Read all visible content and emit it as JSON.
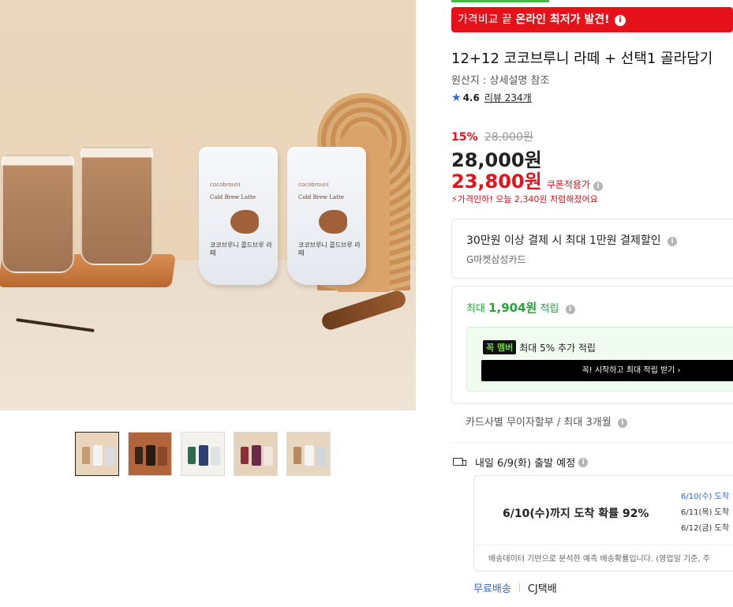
{
  "banner": {
    "prefix": "가격비교 끝 ",
    "strong": "온라인 최저가 발견!",
    "info": "i"
  },
  "product": {
    "title": "12+12 코코브루니 라떼 + 선택1 골라담기",
    "origin": "원산지 : 상세설명 참조",
    "rating": "4.6",
    "review_text": "리뷰 234개"
  },
  "price": {
    "discount_pct": "15%",
    "original": "28,000원",
    "main": "28,000원",
    "coupon": "23,800원",
    "coupon_label": "쿠폰적용가",
    "drop_note": "가격인하! 오늘 2,340원 저렴해졌어요"
  },
  "card_discount": {
    "title": "30만원 이상 결제 시 최대 1만원 결제할인",
    "card": "G마켓삼성카드"
  },
  "points": {
    "prefix": "최대 ",
    "amount": "1,904원",
    "suffix": " 적립",
    "member_badge": "꼭 멤버",
    "member_text": "최대 5% 추가 적립",
    "member_button": "꼭! 시작하고 최대 적립 받기  ›"
  },
  "installment": "카드사별 무이자할부 / 최대 3개월",
  "shipping": {
    "title": "내일 6/9(화) 출발 예정",
    "probability": "6/10(수)까지 도착 확률 92%",
    "dates": [
      "6/10(수) 도착",
      "6/11(목) 도착",
      "6/12(금) 도착"
    ],
    "note": "배송데이터 기반으로 분석한 예측 배송확률입니다. (영업일 기준, 주",
    "free": "무료배송",
    "carrier": "CJ택배"
  },
  "gallery": {
    "pouch_brand": "cocobrouni",
    "pouch_name_en": "Cold Brew Latte",
    "pouch_name_ko": "코코브루니 콜드브루 라떼",
    "thumbnails": [
      {
        "bg": "#e8d5bb",
        "c1": "#c39b73",
        "c2": "#f2f2f2",
        "c3": "#d8dce3"
      },
      {
        "bg": "#b0653a",
        "c1": "#3a2418",
        "c2": "#2b1a12",
        "c3": "#8a4a28"
      },
      {
        "bg": "#f3f1ec",
        "c1": "#2f6b52",
        "c2": "#2d3f6e",
        "c3": "#dfe3e6"
      },
      {
        "bg": "#e6d3bc",
        "c1": "#8a2f3a",
        "c2": "#6b2a48",
        "c3": "#efe7dd"
      },
      {
        "bg": "#e7d6c0",
        "c1": "#b88a60",
        "c2": "#f3f3f3",
        "c3": "#d0d6de"
      }
    ]
  },
  "colors": {
    "accent_red": "#e5111b",
    "accent_blue": "#2f66d8",
    "accent_green": "#2aa33d"
  }
}
